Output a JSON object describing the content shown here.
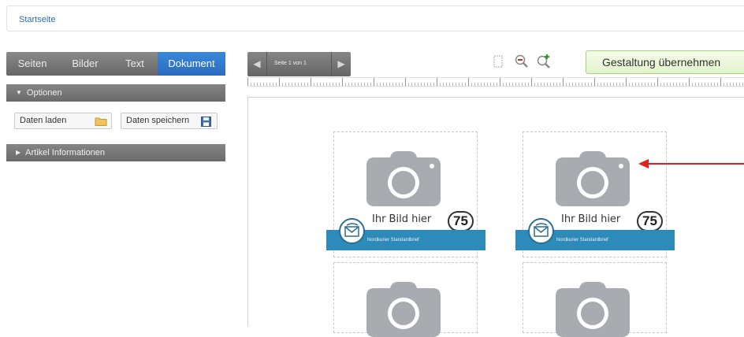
{
  "breadcrumb": {
    "home": "Startseite"
  },
  "tabs": [
    {
      "label": "Seiten"
    },
    {
      "label": "Bilder"
    },
    {
      "label": "Text"
    },
    {
      "label": "Dokument",
      "active": true
    }
  ],
  "sections": {
    "options": "Optionen",
    "article_info": "Artikel Informationen"
  },
  "options": {
    "load_label": "Daten laden",
    "save_label": "Daten speichern"
  },
  "pager": {
    "label": "Seite 1 von 1"
  },
  "toolbar": {
    "apply_label": "Gestaltung übernehmen"
  },
  "stamps": [
    {
      "placeholder": "Ihr Bild hier",
      "value": "75",
      "band": "Nordkurier Standardbrief"
    },
    {
      "placeholder": "Ihr Bild hier",
      "value": "75",
      "band": "Nordkurier Standardbrief"
    }
  ],
  "colors": {
    "active_tab": "#2a6cc0",
    "band": "#2e8ab8",
    "apply_bg": "#e2f3cc",
    "annotation_arrow": "#e02020"
  }
}
